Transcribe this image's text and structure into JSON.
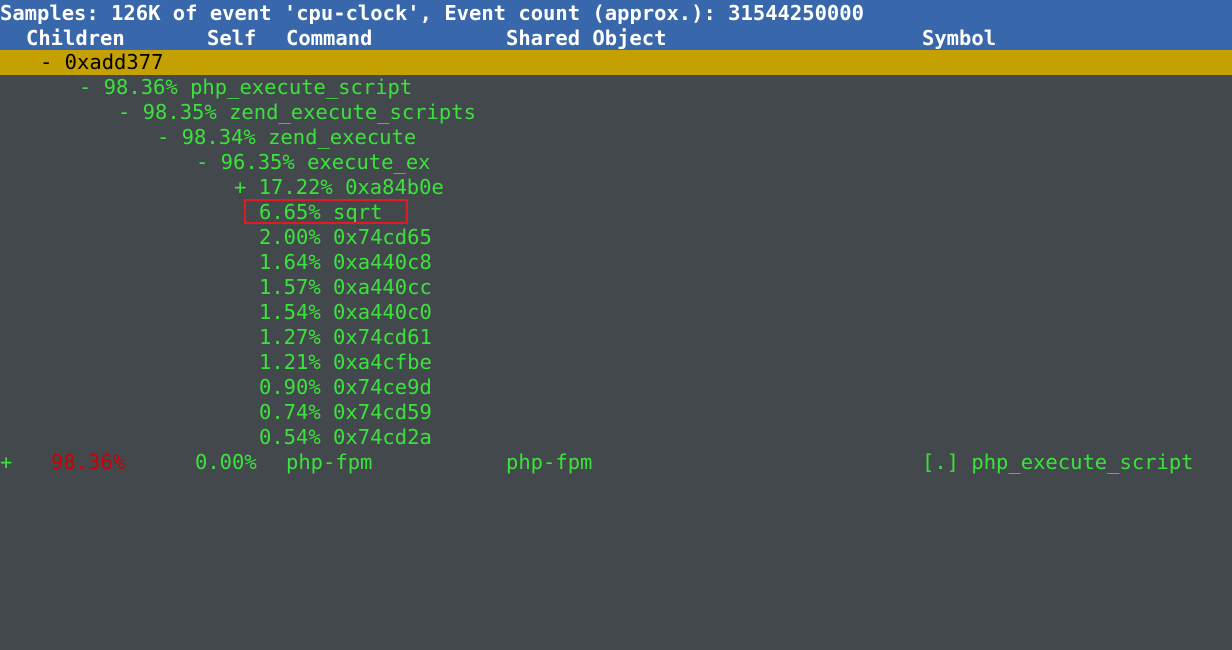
{
  "title": "Samples: 126K of event 'cpu-clock', Event count (approx.): 31544250000",
  "columns": {
    "children": "Children",
    "self": "Self",
    "command": "Command",
    "shared_object": "Shared Object",
    "symbol": "Symbol"
  },
  "tree": [
    {
      "text": "- 0xadd377",
      "selected": true
    },
    {
      "text": "- 98.36% php_execute_script"
    },
    {
      "text": "- 98.35% zend_execute_scripts"
    },
    {
      "text": "- 98.34% zend_execute"
    },
    {
      "text": "- 96.35% execute_ex"
    },
    {
      "text": "+ 17.22% 0xa84b0e"
    },
    {
      "text": "6.65% sqrt",
      "highlighted": true
    },
    {
      "text": "2.00% 0x74cd65"
    },
    {
      "text": "1.64% 0xa440c8"
    },
    {
      "text": "1.57% 0xa440cc"
    },
    {
      "text": "1.54% 0xa440c0"
    },
    {
      "text": "1.27% 0x74cd61"
    },
    {
      "text": "1.21% 0xa4cfbe"
    },
    {
      "text": "0.90% 0x74ce9d"
    },
    {
      "text": "0.74% 0x74cd59"
    },
    {
      "text": "0.54% 0x74cd2a"
    }
  ],
  "footer": {
    "expander": "+",
    "children": "98.36%",
    "self": "0.00%",
    "command": "php-fpm",
    "shared_object": "php-fpm",
    "symbol": "[.] php_execute_script"
  },
  "colors": {
    "background": "#43484d",
    "header": "#3867ab",
    "selected": "#c4a000",
    "text": "#3ce23c",
    "highlight_box": "#e01b24",
    "children_pct": "#cc0000"
  }
}
